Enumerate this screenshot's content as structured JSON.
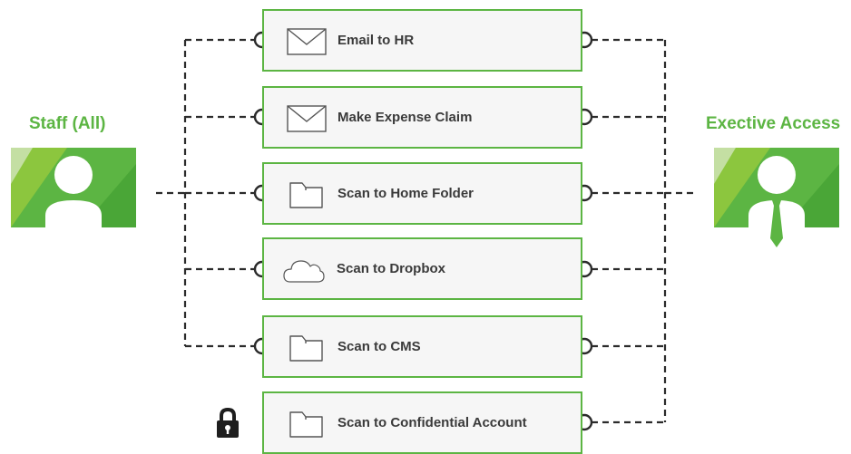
{
  "colors": {
    "accent": "#5cb543",
    "accent_light": "#8cc63e",
    "accent_pale": "#c4dfa3",
    "box_fill": "#f6f6f6",
    "connector": "#2b2b2b",
    "label": "#3a3a3a"
  },
  "roles": {
    "left": {
      "title": "Staff (All)",
      "icon": "user-avatar-icon"
    },
    "right": {
      "title": "Exective Access",
      "icon": "executive-avatar-icon"
    }
  },
  "actions": [
    {
      "label": "Email  to  HR",
      "icon": "envelope-icon",
      "staff_access": true,
      "executive_access": true,
      "locked": false
    },
    {
      "label": "Make Expense Claim",
      "icon": "envelope-icon",
      "staff_access": true,
      "executive_access": true,
      "locked": false
    },
    {
      "label": "Scan to Home Folder",
      "icon": "folder-icon",
      "staff_access": true,
      "executive_access": true,
      "locked": false
    },
    {
      "label": "Scan to Dropbox",
      "icon": "cloud-icon",
      "staff_access": true,
      "executive_access": true,
      "locked": false
    },
    {
      "label": "Scan to CMS",
      "icon": "folder-icon",
      "staff_access": true,
      "executive_access": true,
      "locked": false
    },
    {
      "label": "Scan to Confidential Account",
      "icon": "folder-icon",
      "staff_access": false,
      "executive_access": true,
      "locked": true
    }
  ]
}
